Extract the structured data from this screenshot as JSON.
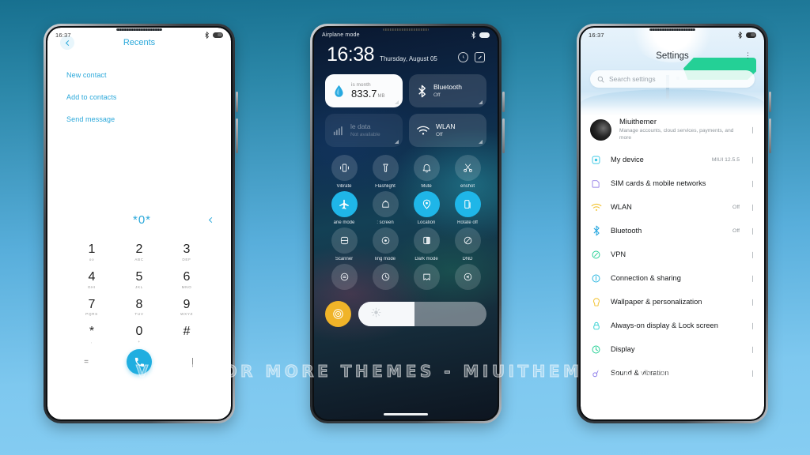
{
  "watermark": "VISIT FOR MORE THEMES - MIUITHEMER.COM",
  "background": {
    "top_color": "#17708f",
    "bottom_color": "#86cdf2"
  },
  "accent": {
    "dialer_blue": "#2aa8da",
    "toggle_on": "#1fb6e8",
    "brightness": "#f0b429",
    "green_shape": "#24d096"
  },
  "phone_dialer": {
    "status": {
      "time": "16:37",
      "icons": [
        "bluetooth-icon",
        "battery-icon"
      ]
    },
    "header": {
      "title": "Recents",
      "back_icon": "chevron-left-icon"
    },
    "actions": [
      "New contact",
      "Add to contacts",
      "Send message"
    ],
    "number_display": "*0*",
    "collapse_icon": "chevron-left-icon",
    "keys": [
      {
        "digit": "1",
        "letters": "oo"
      },
      {
        "digit": "2",
        "letters": "ABC"
      },
      {
        "digit": "3",
        "letters": "DEF"
      },
      {
        "digit": "4",
        "letters": "GHI"
      },
      {
        "digit": "5",
        "letters": "JKL"
      },
      {
        "digit": "6",
        "letters": "MNO"
      },
      {
        "digit": "7",
        "letters": "PQRS"
      },
      {
        "digit": "8",
        "letters": "TUV"
      },
      {
        "digit": "9",
        "letters": "WXYZ"
      },
      {
        "digit": "*",
        "letters": ","
      },
      {
        "digit": "0",
        "letters": "+"
      },
      {
        "digit": "#",
        "letters": ""
      }
    ],
    "bottom": {
      "left_label": "=",
      "call_icon": "phone-icon",
      "right_icon": "chevron-down-icon"
    }
  },
  "phone_control_center": {
    "status": {
      "left_text": "Airplane mode",
      "icons": [
        "bluetooth-icon",
        "battery-icon"
      ]
    },
    "clock": {
      "time": "16:38",
      "date": "Thursday, August 05"
    },
    "header_icons": [
      "alarm-icon",
      "edit-icon"
    ],
    "big_tiles": [
      {
        "title": "is month",
        "value": "833.7",
        "unit": "MB",
        "icon": "data-drop-icon",
        "style": "light"
      },
      {
        "title": "Bluetooth",
        "sub": "Off",
        "icon": "bluetooth-icon",
        "style": "normal"
      },
      {
        "title": "le data",
        "sub": "Not available",
        "icon": "signal-bars-icon",
        "style": "dim"
      },
      {
        "title": "WLAN",
        "sub": "Off",
        "icon": "wifi-icon",
        "style": "normal"
      }
    ],
    "toggles": [
      {
        "label": "Vibrate",
        "icon": "vibrate-icon",
        "on": false
      },
      {
        "label": "Flashlight",
        "icon": "flashlight-icon",
        "on": false
      },
      {
        "label": "Mute",
        "icon": "bell-mute-icon",
        "on": false
      },
      {
        "label": "enshot",
        "icon": "scissors-icon",
        "on": false
      },
      {
        "label": "ane mode",
        "icon": "airplane-icon",
        "on": true
      },
      {
        "label": ": screen",
        "icon": "cast-screen-icon",
        "on": false
      },
      {
        "label": "Location",
        "icon": "location-pin-icon",
        "on": true
      },
      {
        "label": "Rotate off",
        "icon": "rotate-lock-icon",
        "on": true
      },
      {
        "label": "Scanner",
        "icon": "scanner-icon",
        "on": false
      },
      {
        "label": "ling mode",
        "icon": "reading-mode-icon",
        "on": false
      },
      {
        "label": "Dark mode",
        "icon": "dark-mode-icon",
        "on": false
      },
      {
        "label": "DND",
        "icon": "dnd-icon",
        "on": false
      },
      {
        "label": "",
        "icon": "battery-saver-icon",
        "on": false
      },
      {
        "label": "",
        "icon": "add-icon",
        "on": false
      },
      {
        "label": "",
        "icon": "wallet-icon",
        "on": false
      },
      {
        "label": "",
        "icon": "volume-icon",
        "on": false
      }
    ],
    "brightness": {
      "button_icon": "auto-brightness-icon",
      "slider_icon": "sun-icon",
      "level_percent": 44
    }
  },
  "phone_settings": {
    "status": {
      "time": "16:37",
      "icons": [
        "bluetooth-icon",
        "battery-icon"
      ]
    },
    "title": "Settings",
    "more_icon": "more-vertical-icon",
    "search": {
      "placeholder": "Search settings",
      "icon": "search-icon"
    },
    "account": {
      "name": "Miuithemer",
      "description": "Manage accounts, cloud services, payments, and more",
      "avatar": "user-avatar"
    },
    "items": [
      {
        "label": "My device",
        "value": "MIUI 12.5.5",
        "icon": "device-icon",
        "color": "#3fc9e5"
      },
      {
        "label": "SIM cards & mobile networks",
        "value": "",
        "icon": "sim-card-icon",
        "color": "#9b86e8"
      },
      {
        "label": "WLAN",
        "value": "Off",
        "icon": "wifi-icon",
        "color": "#f2c230"
      },
      {
        "label": "Bluetooth",
        "value": "Off",
        "icon": "bluetooth-icon",
        "color": "#29a8e0"
      },
      {
        "label": "VPN",
        "value": "",
        "icon": "vpn-icon",
        "color": "#23cf94"
      },
      {
        "label": "Connection & sharing",
        "value": "",
        "icon": "connection-icon",
        "color": "#29b6e0"
      },
      {
        "label": "Wallpaper & personalization",
        "value": "",
        "icon": "wallpaper-icon",
        "color": "#f2c230"
      },
      {
        "label": "Always-on display & Lock screen",
        "value": "",
        "icon": "lock-screen-icon",
        "color": "#2ecfd0"
      },
      {
        "label": "Display",
        "value": "",
        "icon": "display-icon",
        "color": "#23cf94"
      },
      {
        "label": "Sound & vibration",
        "value": "",
        "icon": "sound-icon",
        "color": "#8b7bea"
      }
    ],
    "arrow_icon": "chevron-right-icon"
  }
}
